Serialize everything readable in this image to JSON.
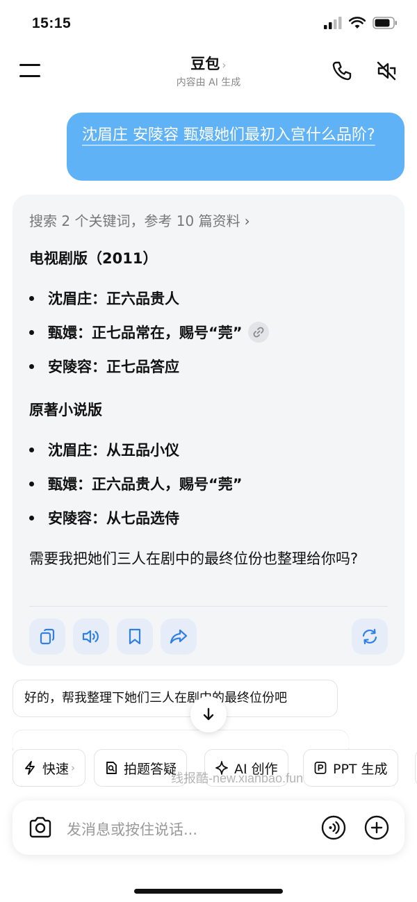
{
  "status_bar": {
    "time": "15:15"
  },
  "header": {
    "title": "豆包",
    "subtitle": "内容由 AI 生成"
  },
  "user_message": "沈眉庄 安陵容 甄嬛她们最初入宫什么品阶?",
  "ai_message": {
    "search_ref": "搜索 2 个关键词，参考 10 篇资料",
    "sections": [
      {
        "heading": "电视剧版（2011）",
        "items": [
          {
            "name": "沈眉庄",
            "rank": "正六品贵人"
          },
          {
            "name": "甄嬛",
            "rank": "正七品常在，赐号“莞”"
          },
          {
            "name": "安陵容",
            "rank": "正七品答应"
          }
        ]
      },
      {
        "heading": "原著小说版",
        "items": [
          {
            "name": "沈眉庄",
            "rank": "从五品小仪"
          },
          {
            "name": "甄嬛",
            "rank": "正六品贵人，赐号“莞”"
          },
          {
            "name": "安陵容",
            "rank": "从七品选侍"
          }
        ]
      }
    ],
    "follow_up": "需要我把她们三人在剧中的最终位份也整理给你吗?",
    "separator": "："
  },
  "suggestion": "好的，帮我整理下她们三人在剧中的最终位份吧",
  "quick_actions": [
    {
      "label": "快速",
      "icon": "lightning-icon"
    },
    {
      "label": "拍题答疑",
      "icon": "photo-question-icon"
    },
    {
      "label": "AI 创作",
      "icon": "sparkle-icon"
    },
    {
      "label": "PPT 生成",
      "icon": "ppt-icon"
    }
  ],
  "watermark": "线报酷-new.xianbao.fun",
  "composer": {
    "placeholder": "发消息或按住说话..."
  },
  "colors": {
    "user_bubble": "#5eb2f5",
    "action_bg": "#e6edf8",
    "accent": "#2f7fe6"
  }
}
